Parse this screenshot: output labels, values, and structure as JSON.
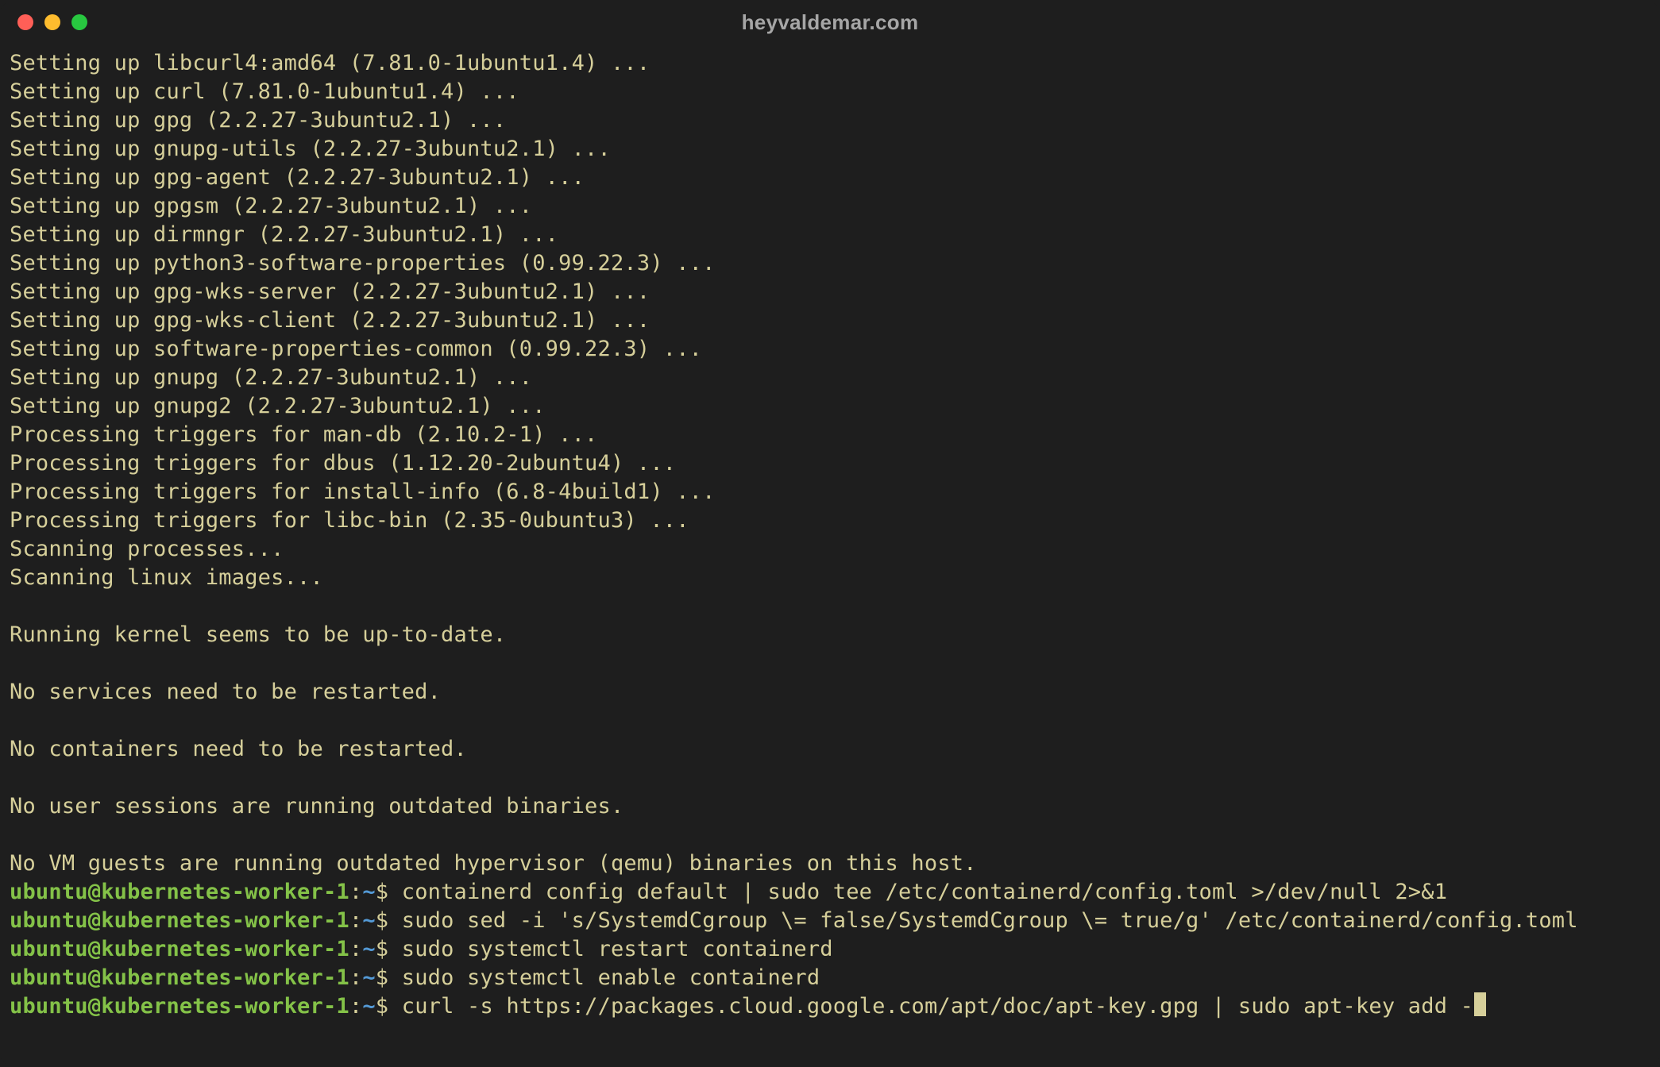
{
  "window": {
    "title": "heyvaldemar.com"
  },
  "colors": {
    "bg": "#1e1e1e",
    "text": "#d6cf9a",
    "prompt_user": "#84c248",
    "prompt_cwd": "#549ad6",
    "traffic_red": "#ff5f57",
    "traffic_yellow": "#febc2e",
    "traffic_green": "#28c840"
  },
  "output_lines": [
    "Setting up libcurl4:amd64 (7.81.0-1ubuntu1.4) ...",
    "Setting up curl (7.81.0-1ubuntu1.4) ...",
    "Setting up gpg (2.2.27-3ubuntu2.1) ...",
    "Setting up gnupg-utils (2.2.27-3ubuntu2.1) ...",
    "Setting up gpg-agent (2.2.27-3ubuntu2.1) ...",
    "Setting up gpgsm (2.2.27-3ubuntu2.1) ...",
    "Setting up dirmngr (2.2.27-3ubuntu2.1) ...",
    "Setting up python3-software-properties (0.99.22.3) ...",
    "Setting up gpg-wks-server (2.2.27-3ubuntu2.1) ...",
    "Setting up gpg-wks-client (2.2.27-3ubuntu2.1) ...",
    "Setting up software-properties-common (0.99.22.3) ...",
    "Setting up gnupg (2.2.27-3ubuntu2.1) ...",
    "Setting up gnupg2 (2.2.27-3ubuntu2.1) ...",
    "Processing triggers for man-db (2.10.2-1) ...",
    "Processing triggers for dbus (1.12.20-2ubuntu4) ...",
    "Processing triggers for install-info (6.8-4build1) ...",
    "Processing triggers for libc-bin (2.35-0ubuntu3) ...",
    "Scanning processes...",
    "Scanning linux images...",
    "",
    "Running kernel seems to be up-to-date.",
    "",
    "No services need to be restarted.",
    "",
    "No containers need to be restarted.",
    "",
    "No user sessions are running outdated binaries.",
    "",
    "No VM guests are running outdated hypervisor (qemu) binaries on this host."
  ],
  "prompt": {
    "user": "ubuntu",
    "at": "@",
    "host": "kubernetes-worker-1",
    "colon": ":",
    "cwd": "~",
    "dollar": "$"
  },
  "commands": [
    {
      "cmd": "containerd config default | sudo tee /etc/containerd/config.toml >/dev/null 2>&1",
      "cursor": false
    },
    {
      "cmd": "sudo sed -i 's/SystemdCgroup \\= false/SystemdCgroup \\= true/g' /etc/containerd/config.toml",
      "cursor": false
    },
    {
      "cmd": "sudo systemctl restart containerd",
      "cursor": false
    },
    {
      "cmd": "sudo systemctl enable containerd",
      "cursor": false
    },
    {
      "cmd": "curl -s https://packages.cloud.google.com/apt/doc/apt-key.gpg | sudo apt-key add -",
      "cursor": true
    }
  ]
}
